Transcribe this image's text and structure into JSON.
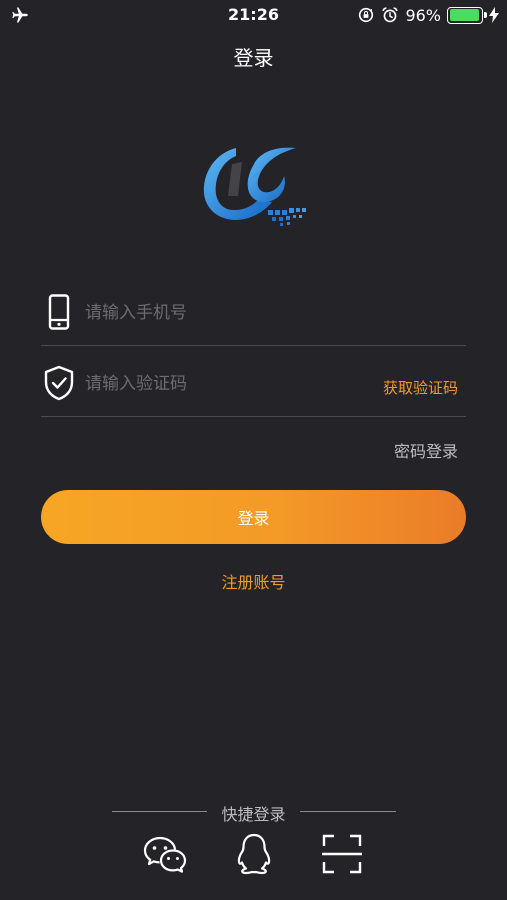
{
  "status_bar": {
    "time": "21:26",
    "battery_percent": "96%",
    "battery_level": 0.96,
    "icons": [
      "airplane-icon",
      "orientation-lock-icon",
      "alarm-icon",
      "battery-icon",
      "charging-icon"
    ]
  },
  "nav": {
    "title": "登录"
  },
  "form": {
    "phone_placeholder": "请输入手机号",
    "phone_value": "",
    "code_placeholder": "请输入验证码",
    "code_value": "",
    "get_code_label": "获取验证码",
    "password_login_label": "密码登录",
    "submit_label": "登录",
    "register_label": "注册账号"
  },
  "quick_login": {
    "label": "快捷登录",
    "items": [
      "wechat-icon",
      "qq-icon",
      "scan-icon"
    ]
  },
  "colors": {
    "background": "#242327",
    "accent": "#f39a2a",
    "button_start": "#f6a624",
    "button_end": "#ea7c28",
    "logo_blue": "#1e8be0",
    "battery_green": "#4cd964"
  }
}
